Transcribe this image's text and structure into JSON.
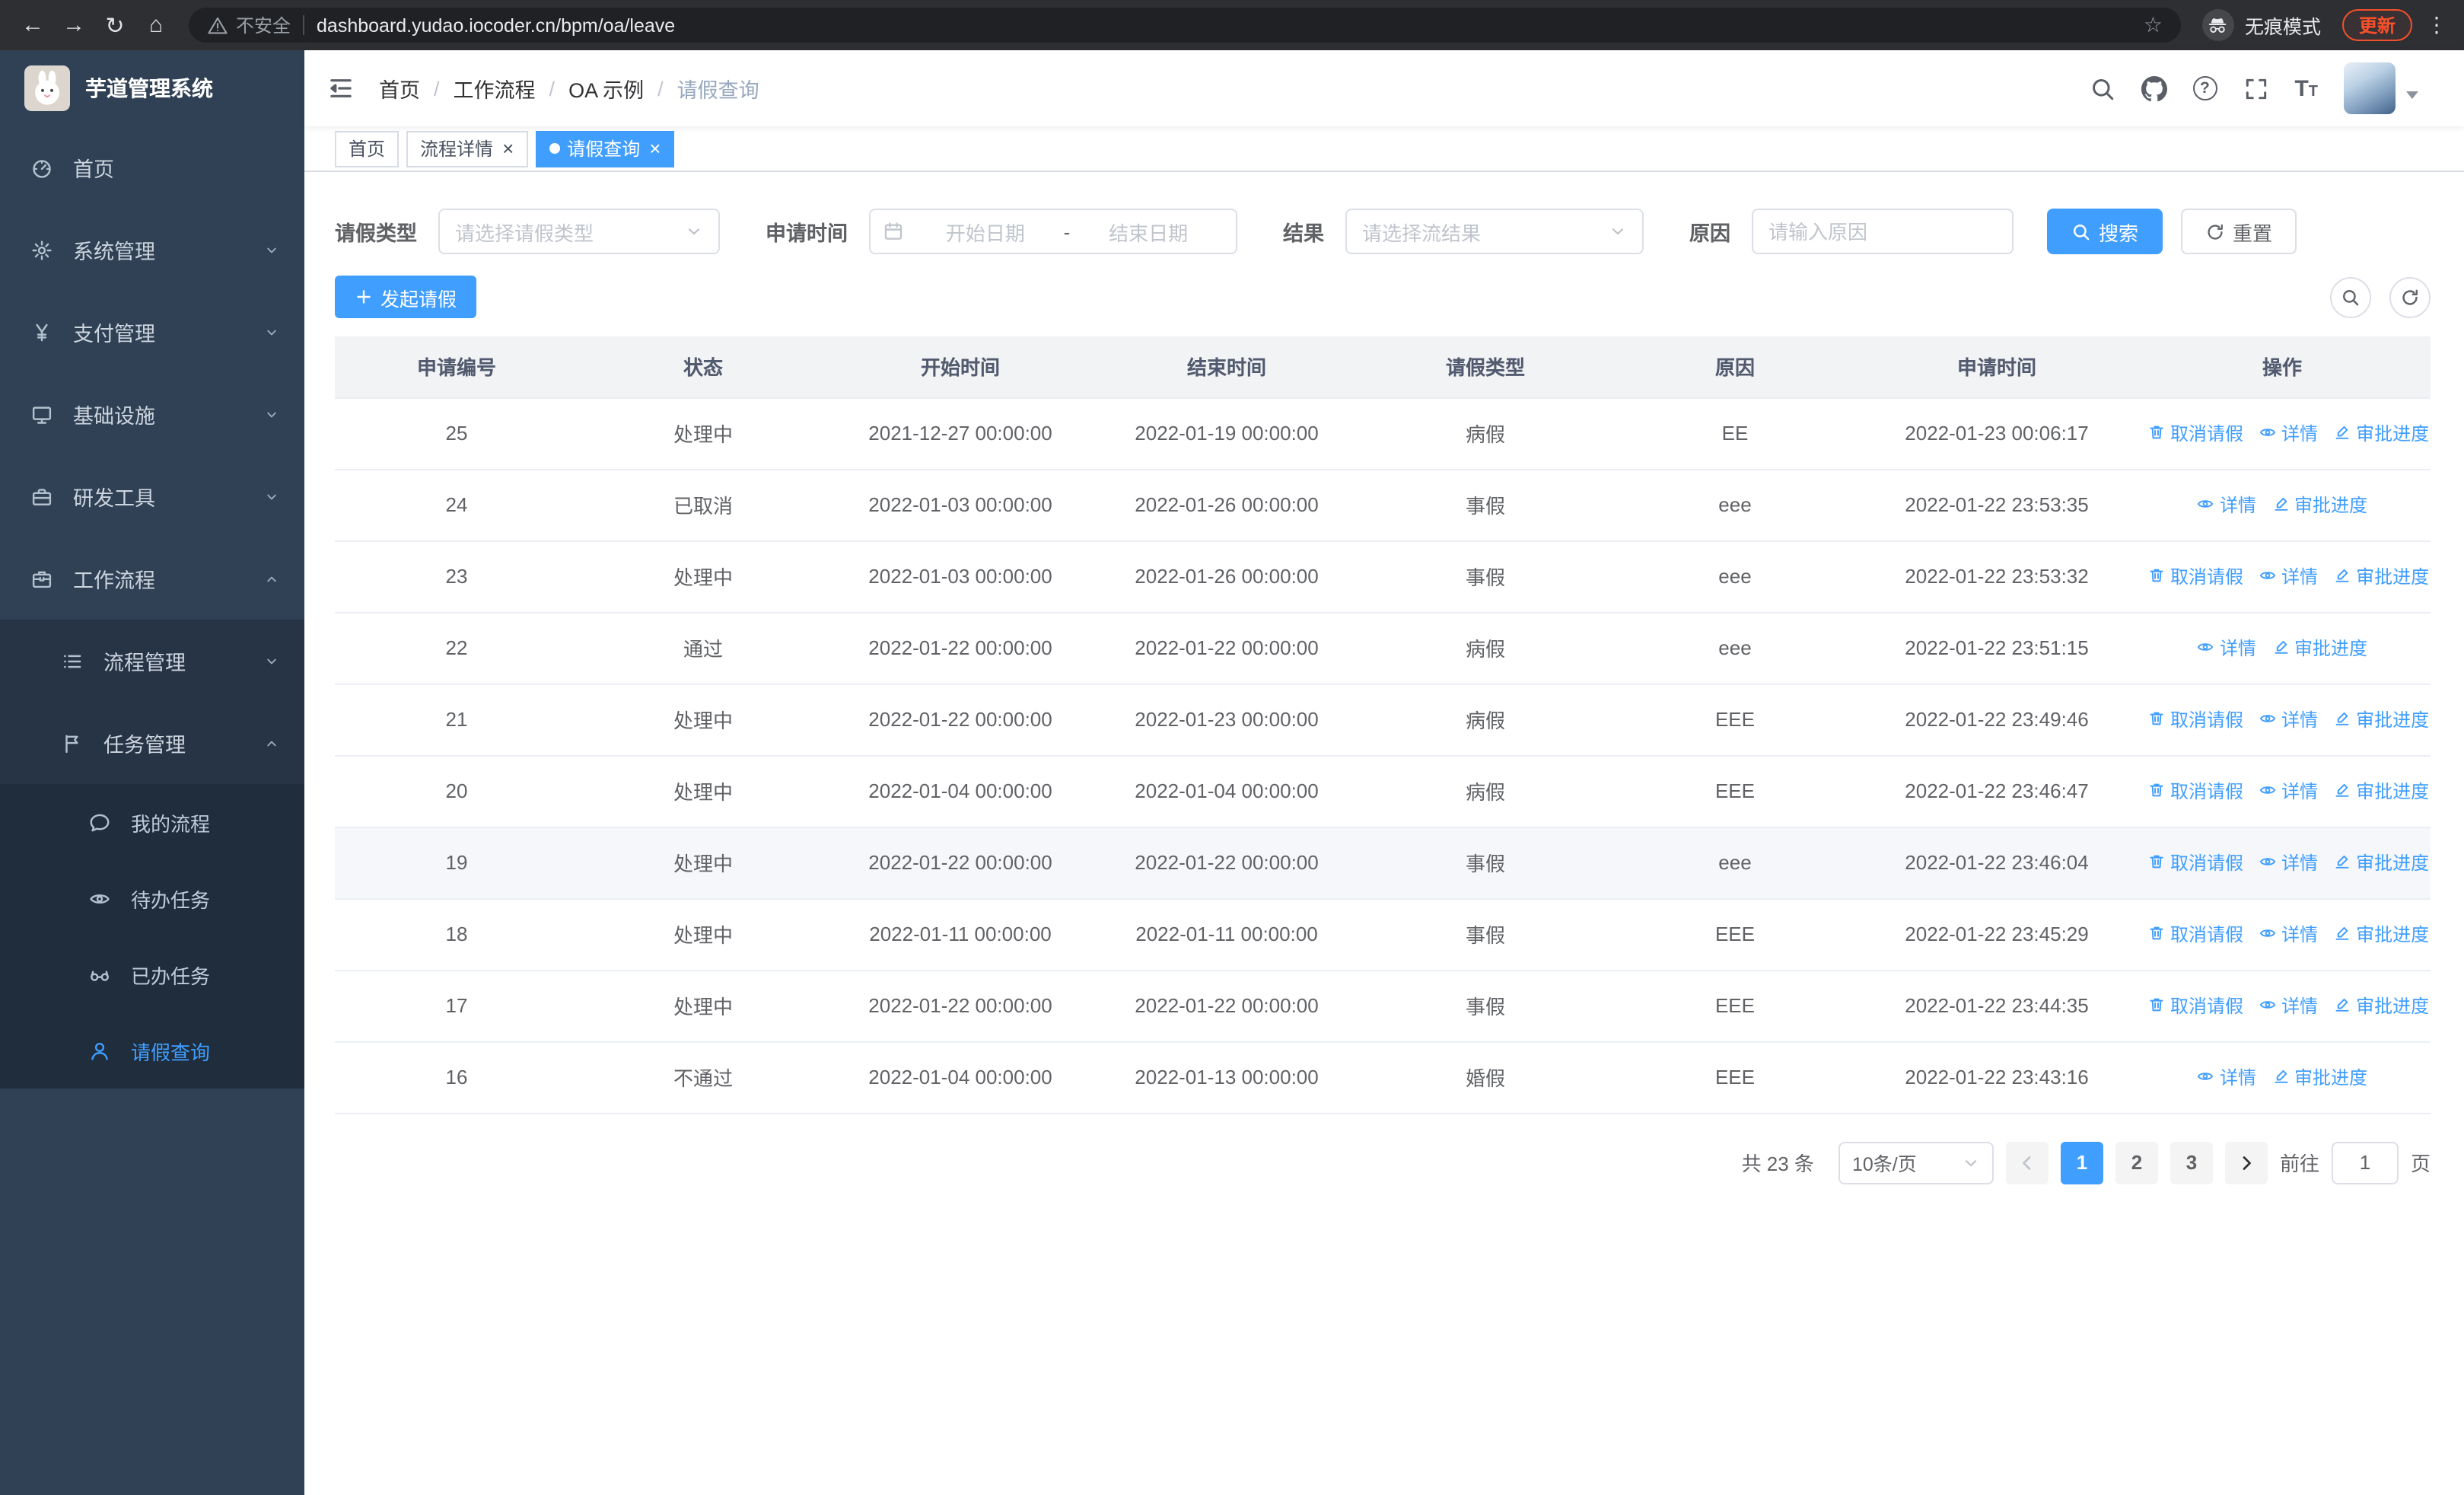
{
  "browser": {
    "security_warning": "不安全",
    "url": "dashboard.yudao.iocoder.cn/bpm/oa/leave",
    "incognito_label": "无痕模式",
    "update_label": "更新"
  },
  "sidebar": {
    "logo_title": "芋道管理系统",
    "menu": [
      {
        "key": "home",
        "label": "首页",
        "icon": "gauge-icon",
        "level": 1
      },
      {
        "key": "system",
        "label": "系统管理",
        "icon": "gear-icon",
        "level": 1,
        "arrow": "down"
      },
      {
        "key": "payment",
        "label": "支付管理",
        "icon": "yen-icon",
        "level": 1,
        "arrow": "down"
      },
      {
        "key": "infrastructure",
        "label": "基础设施",
        "icon": "monitor-icon",
        "level": 1,
        "arrow": "down"
      },
      {
        "key": "dev-tools",
        "label": "研发工具",
        "icon": "toolbox-icon",
        "level": 1,
        "arrow": "down"
      },
      {
        "key": "workflow",
        "label": "工作流程",
        "icon": "briefcase-icon",
        "level": 1,
        "arrow": "up"
      },
      {
        "key": "process-mgmt",
        "label": "流程管理",
        "icon": "list-icon",
        "level": 2,
        "arrow": "down"
      },
      {
        "key": "task-mgmt",
        "label": "任务管理",
        "icon": "flag-icon",
        "level": 2,
        "arrow": "up"
      },
      {
        "key": "my-process",
        "label": "我的流程",
        "icon": "chat-icon",
        "level": 3
      },
      {
        "key": "todo-task",
        "label": "待办任务",
        "icon": "eye-icon",
        "level": 3
      },
      {
        "key": "done-task",
        "label": "已办任务",
        "icon": "glasses-icon",
        "level": 3
      },
      {
        "key": "leave-query",
        "label": "请假查询",
        "icon": "user-icon",
        "level": 3,
        "active": true
      }
    ]
  },
  "header": {
    "breadcrumb": [
      "首页",
      "工作流程",
      "OA 示例",
      "请假查询"
    ],
    "separator": "/"
  },
  "tabs": [
    {
      "key": "home",
      "label": "首页",
      "closable": false,
      "active": false
    },
    {
      "key": "process-detail",
      "label": "流程详情",
      "closable": true,
      "active": false
    },
    {
      "key": "leave-query",
      "label": "请假查询",
      "closable": true,
      "active": true
    }
  ],
  "filters": {
    "leave_type": {
      "label": "请假类型",
      "placeholder": "请选择请假类型"
    },
    "apply_time": {
      "label": "申请时间",
      "start_placeholder": "开始日期",
      "separator": "-",
      "end_placeholder": "结束日期"
    },
    "result": {
      "label": "结果",
      "placeholder": "请选择流结果"
    },
    "reason": {
      "label": "原因",
      "placeholder": "请输入原因"
    },
    "search_button": "搜索",
    "reset_button": "重置"
  },
  "toolbar": {
    "create_button": "发起请假"
  },
  "table": {
    "columns": [
      "申请编号",
      "状态",
      "开始时间",
      "结束时间",
      "请假类型",
      "原因",
      "申请时间",
      "操作"
    ],
    "action_labels": {
      "cancel": "取消请假",
      "detail": "详情",
      "progress": "审批进度"
    },
    "rows": [
      {
        "id": "25",
        "status": "处理中",
        "start": "2021-12-27 00:00:00",
        "end": "2022-01-19 00:00:00",
        "type": "病假",
        "reason": "EE",
        "apply": "2022-01-23 00:06:17",
        "actions": [
          "cancel",
          "detail",
          "progress"
        ]
      },
      {
        "id": "24",
        "status": "已取消",
        "start": "2022-01-03 00:00:00",
        "end": "2022-01-26 00:00:00",
        "type": "事假",
        "reason": "eee",
        "apply": "2022-01-22 23:53:35",
        "actions": [
          "detail",
          "progress"
        ]
      },
      {
        "id": "23",
        "status": "处理中",
        "start": "2022-01-03 00:00:00",
        "end": "2022-01-26 00:00:00",
        "type": "事假",
        "reason": "eee",
        "apply": "2022-01-22 23:53:32",
        "actions": [
          "cancel",
          "detail",
          "progress"
        ]
      },
      {
        "id": "22",
        "status": "通过",
        "start": "2022-01-22 00:00:00",
        "end": "2022-01-22 00:00:00",
        "type": "病假",
        "reason": "eee",
        "apply": "2022-01-22 23:51:15",
        "actions": [
          "detail",
          "progress"
        ]
      },
      {
        "id": "21",
        "status": "处理中",
        "start": "2022-01-22 00:00:00",
        "end": "2022-01-23 00:00:00",
        "type": "病假",
        "reason": "EEE",
        "apply": "2022-01-22 23:49:46",
        "actions": [
          "cancel",
          "detail",
          "progress"
        ]
      },
      {
        "id": "20",
        "status": "处理中",
        "start": "2022-01-04 00:00:00",
        "end": "2022-01-04 00:00:00",
        "type": "病假",
        "reason": "EEE",
        "apply": "2022-01-22 23:46:47",
        "actions": [
          "cancel",
          "detail",
          "progress"
        ]
      },
      {
        "id": "19",
        "status": "处理中",
        "start": "2022-01-22 00:00:00",
        "end": "2022-01-22 00:00:00",
        "type": "事假",
        "reason": "eee",
        "apply": "2022-01-22 23:46:04",
        "actions": [
          "cancel",
          "detail",
          "progress"
        ],
        "highlighted": true
      },
      {
        "id": "18",
        "status": "处理中",
        "start": "2022-01-11 00:00:00",
        "end": "2022-01-11 00:00:00",
        "type": "事假",
        "reason": "EEE",
        "apply": "2022-01-22 23:45:29",
        "actions": [
          "cancel",
          "detail",
          "progress"
        ]
      },
      {
        "id": "17",
        "status": "处理中",
        "start": "2022-01-22 00:00:00",
        "end": "2022-01-22 00:00:00",
        "type": "事假",
        "reason": "EEE",
        "apply": "2022-01-22 23:44:35",
        "actions": [
          "cancel",
          "detail",
          "progress"
        ]
      },
      {
        "id": "16",
        "status": "不通过",
        "start": "2022-01-04 00:00:00",
        "end": "2022-01-13 00:00:00",
        "type": "婚假",
        "reason": "EEE",
        "apply": "2022-01-22 23:43:16",
        "actions": [
          "detail",
          "progress"
        ]
      }
    ]
  },
  "pagination": {
    "total_text": "共 23 条",
    "page_size_text": "10条/页",
    "pages": [
      "1",
      "2",
      "3"
    ],
    "active_page": "1",
    "goto_prefix": "前往",
    "goto_value": "1",
    "goto_suffix": "页"
  },
  "colors": {
    "accent": "#409eff",
    "sidebar_bg": "#304156",
    "sidebar_sub_bg": "#263445",
    "sidebar_deep_bg": "#1f2d3d",
    "table_header_bg": "#f2f3f5",
    "update_chip": "#f4502c",
    "chrome_bg": "#2e2f33",
    "omnibox_bg": "#202124"
  }
}
